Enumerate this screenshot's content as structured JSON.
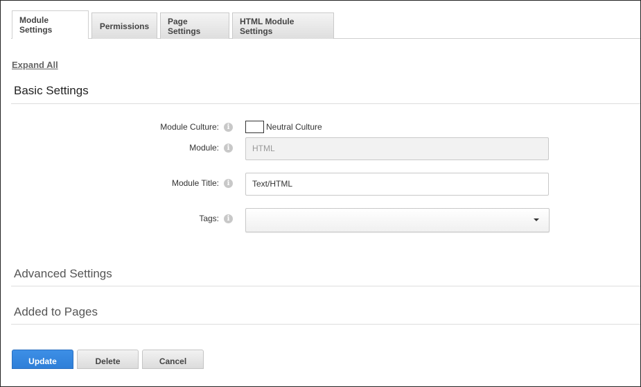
{
  "tabs": [
    {
      "label": "Module Settings",
      "active": true
    },
    {
      "label": "Permissions",
      "active": false
    },
    {
      "label": "Page Settings",
      "active": false
    },
    {
      "label": "HTML Module Settings",
      "active": false
    }
  ],
  "expand_all": "Expand All",
  "sections": {
    "basic": "Basic Settings",
    "advanced": "Advanced Settings",
    "added_to_pages": "Added to Pages"
  },
  "form": {
    "module_culture": {
      "label": "Module Culture:",
      "checkbox_label": "Neutral Culture",
      "checked": false
    },
    "module": {
      "label": "Module:",
      "value": "HTML"
    },
    "module_title": {
      "label": "Module Title:",
      "value": "Text/HTML"
    },
    "tags": {
      "label": "Tags:",
      "value": ""
    }
  },
  "icons": {
    "info": "info-icon",
    "dropdown": "chevron-down-icon"
  },
  "buttons": {
    "update": "Update",
    "delete": "Delete",
    "cancel": "Cancel"
  },
  "colors": {
    "primary": "#2f7fd8"
  }
}
